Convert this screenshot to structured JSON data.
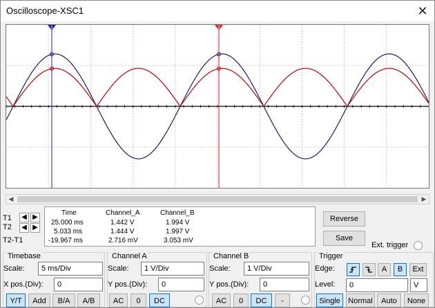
{
  "window": {
    "title": "Oscilloscope-XSC1",
    "close_glyph": "✕"
  },
  "screen": {
    "background": "#ffffff",
    "grid_color": "#c8c8c8",
    "channel_a_color": "#c00000",
    "channel_b_color": "#1a1a6e",
    "cursor_t1_color": "#2222aa",
    "cursor_t2_color": "#dd2222",
    "cursor_t1_label": "1",
    "cursor_t2_label": "2"
  },
  "scrollbar": {
    "left_arrow": "◀",
    "right_arrow": "▶"
  },
  "cursors": {
    "t1_label": "T1",
    "t2_label": "T2",
    "diff_label": "T2-T1",
    "left_arrow": "◀",
    "right_arrow": "▶"
  },
  "readout": {
    "headers": {
      "time": "Time",
      "channel_a": "Channel_A",
      "channel_b": "Channel_B"
    },
    "rows": [
      {
        "time": "25.000 ms",
        "channel_a": "1.442 V",
        "channel_b": "1.994 V"
      },
      {
        "time": "5.033 ms",
        "channel_a": "1.444 V",
        "channel_b": "1.997 V"
      },
      {
        "time": "-19.967 ms",
        "channel_a": "2.716 mV",
        "channel_b": "3.053 mV"
      }
    ]
  },
  "actions": {
    "reverse": "Reverse",
    "save": "Save",
    "ext_trigger": "Ext. trigger"
  },
  "timebase": {
    "title": "Timebase",
    "scale_label": "Scale:",
    "scale_value": "5 ms/Div",
    "xpos_label": "X pos.(Div):",
    "xpos_value": "0",
    "modes": [
      "Y/T",
      "Add",
      "B/A",
      "A/B"
    ],
    "active_mode": "Y/T"
  },
  "channel_a": {
    "title": "Channel A",
    "scale_label": "Scale:",
    "scale_value": "1  V/Div",
    "ypos_label": "Y pos.(Div):",
    "ypos_value": "0",
    "coupling": [
      "AC",
      "0",
      "DC"
    ],
    "active_coupling": "DC"
  },
  "channel_b": {
    "title": "Channel B",
    "scale_label": "Scale:",
    "scale_value": "1  V/Div",
    "ypos_label": "Y pos.(Div):",
    "ypos_value": "0",
    "coupling": [
      "AC",
      "0",
      "DC",
      "-"
    ],
    "active_coupling": "DC"
  },
  "trigger": {
    "title": "Trigger",
    "edge_label": "Edge:",
    "edge_rising_icon": "rising-edge-icon",
    "edge_falling_icon": "falling-edge-icon",
    "sources": [
      "A",
      "B",
      "Ext"
    ],
    "active_source": "B",
    "level_label": "Level:",
    "level_value": "0",
    "level_unit": "V",
    "modes": [
      "Single",
      "Normal",
      "Auto",
      "None"
    ],
    "active_mode": "Single"
  }
}
